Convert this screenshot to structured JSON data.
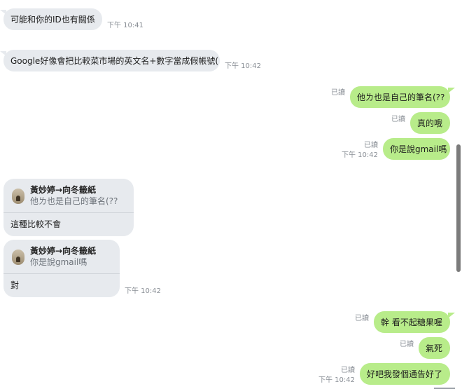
{
  "messages": [
    {
      "text": "可能和你的ID也有關係",
      "time": "下午 10:41"
    },
    {
      "text": "Google好像會把比較菜市場的英文名+數字當成假帳號(",
      "time": "下午 10:42"
    },
    {
      "text": "他ㄌ也是自己的筆名(??",
      "read": "已讀"
    },
    {
      "text": "真的哦",
      "read": "已讀"
    },
    {
      "text": "你是說gmail嗎",
      "read": "已讀",
      "time": "下午 10:42"
    },
    {
      "reply_name": "黃妙婷→向冬籤紙",
      "reply_quote": "他ㄌ也是自己的筆名(??",
      "text": "這種比較不會"
    },
    {
      "reply_name": "黃妙婷→向冬籤紙",
      "reply_quote": "你是說gmail嗎",
      "text": "對",
      "time": "下午 10:42"
    },
    {
      "text": "幹 看不起糖果喔",
      "read": "已讀"
    },
    {
      "text": "氣死",
      "read": "已讀"
    },
    {
      "text": "好吧我發個通告好了",
      "read": "已讀",
      "time": "下午 10:42"
    }
  ],
  "colors": {
    "incoming_bubble": "#e7eaee",
    "outgoing_bubble": "#b8ec8a",
    "meta_text": "#8a8f96",
    "scrollbar": "#7b7b7b"
  },
  "icons": {
    "avatar": "user-avatar-icon"
  }
}
